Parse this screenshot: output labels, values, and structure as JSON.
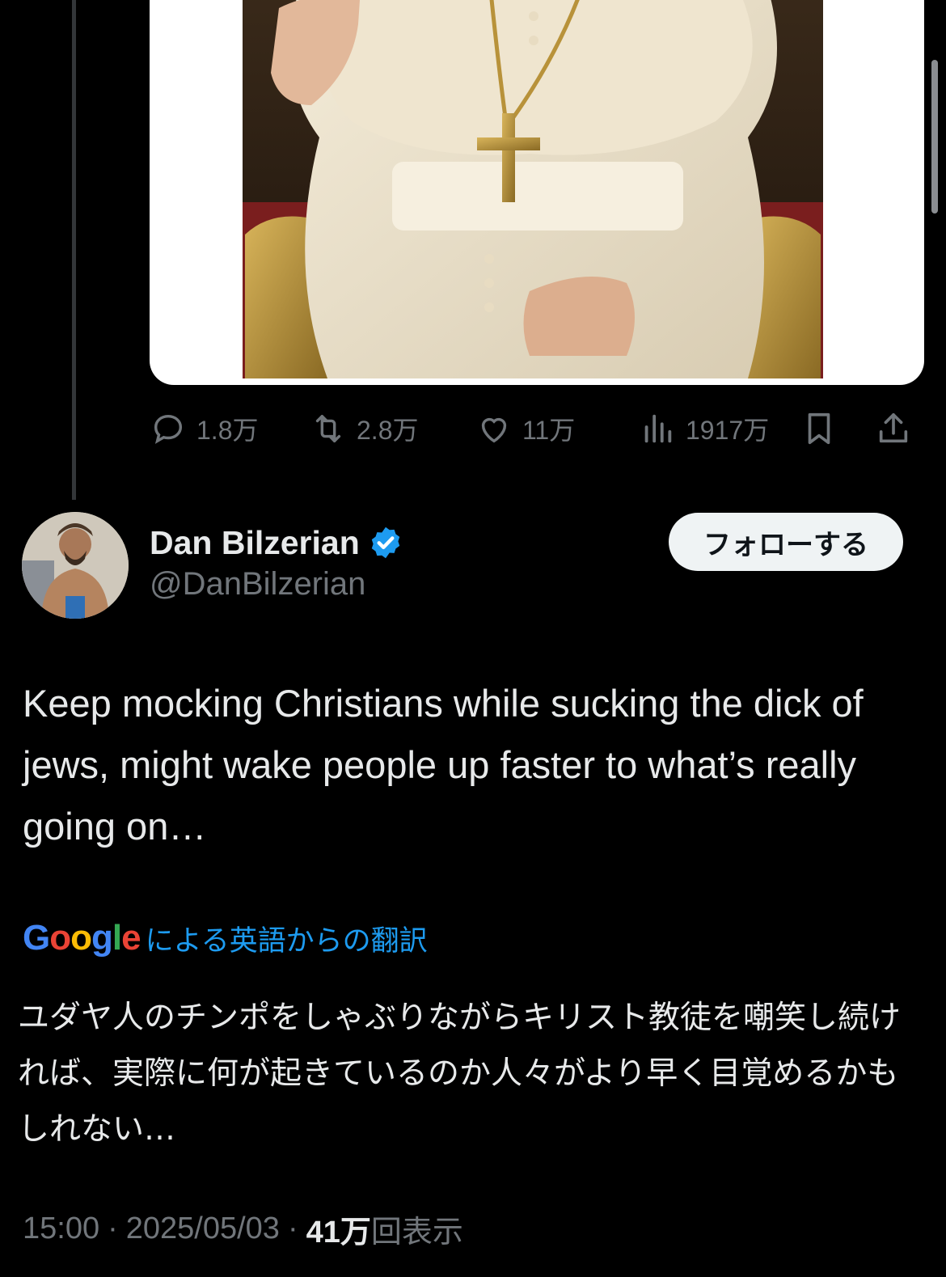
{
  "media": {
    "description_icon": "pope-image"
  },
  "actions": {
    "replies": "1.8万",
    "retweets": "2.8万",
    "likes": "11万",
    "views": "1917万"
  },
  "author": {
    "name": "Dan Bilzerian",
    "handle": "@DanBilzerian",
    "verified": true,
    "follow_label": "フォローする"
  },
  "tweet": {
    "text": "Keep mocking Christians while sucking the dick of jews, might wake people up faster to what’s really going on…"
  },
  "translation": {
    "provider": "Google",
    "label": "による英語からの翻訳",
    "text": "ユダヤ人のチンポをしゃぶりながらキリスト教徒を嘲笑し続ければ、実際に何が起きているのか人々がより早く目覚めるかもしれない…"
  },
  "meta": {
    "time": "15:00",
    "date": "2025/05/03",
    "view_count": "41万",
    "view_label": "回表示",
    "separator": "·"
  },
  "colors": {
    "background": "#000000",
    "text": "#e7e9ea",
    "muted": "#71767b",
    "link": "#1d9bf0",
    "verified": "#1d9bf0"
  }
}
